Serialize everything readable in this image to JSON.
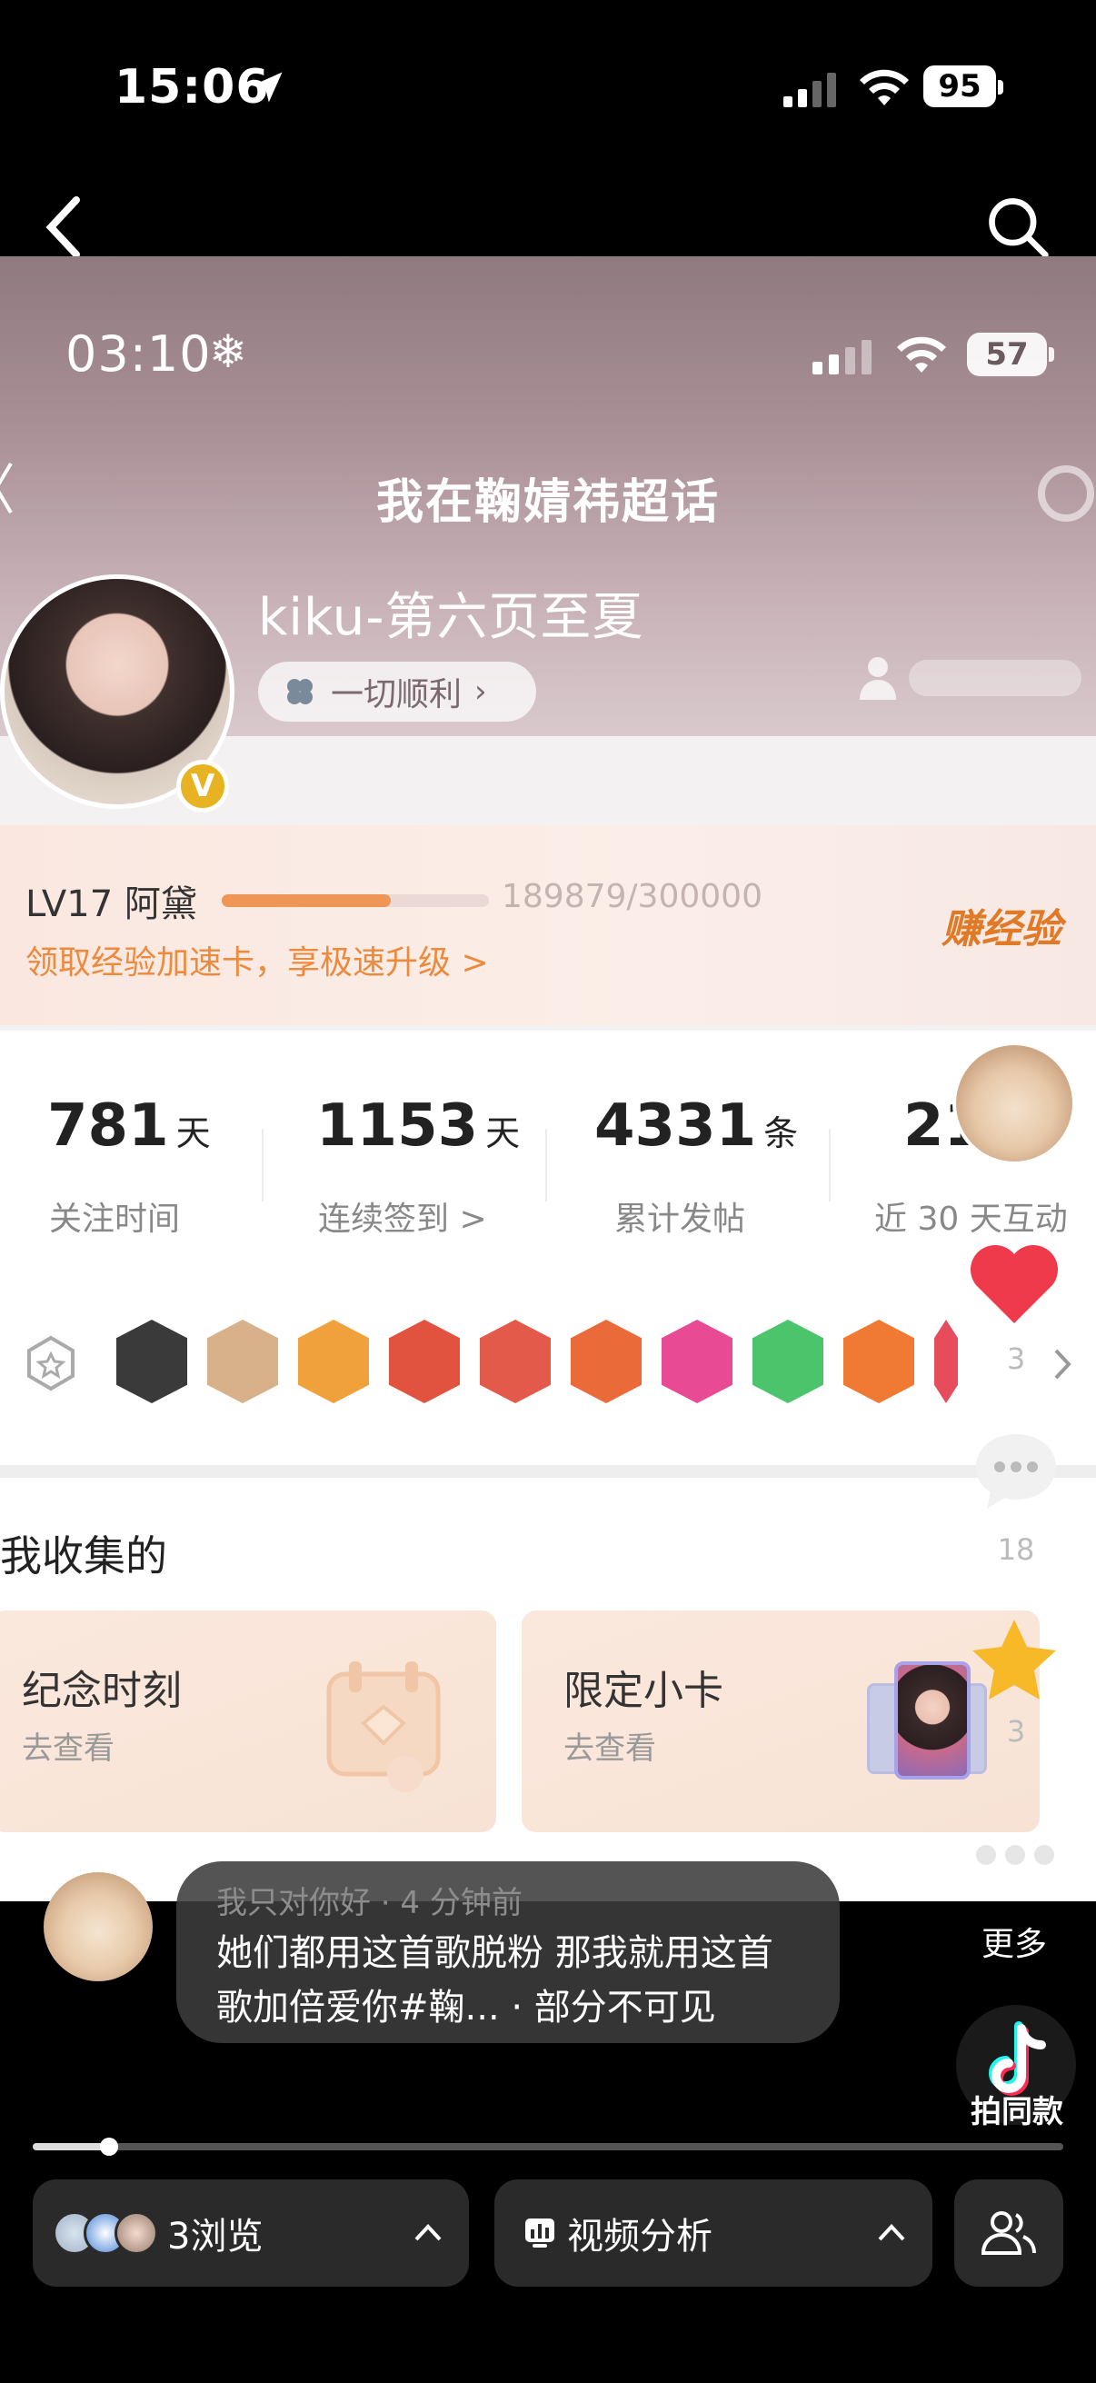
{
  "status_bar": {
    "time": "15:06",
    "battery": "95"
  },
  "video": {
    "inner_status": {
      "time": "03:10",
      "battery": "57"
    },
    "super_topic_title": "我在鞠婧祎超话",
    "username": "kiku-第六页至夏",
    "wish_pill": "一切顺利",
    "verified_mark": "V",
    "level": {
      "label": "LV17 阿黛",
      "current": 189879,
      "max": 300000,
      "count_text": "189879/300000",
      "promo": "领取经验加速卡，享极速升级 >",
      "earn_button": "赚经验"
    },
    "stats": [
      {
        "value": "781",
        "unit": "天",
        "label": "关注时间"
      },
      {
        "value": "1153",
        "unit": "天",
        "label": "连续签到 >"
      },
      {
        "value": "4331",
        "unit": "条",
        "label": "累计发帖"
      },
      {
        "value": "21",
        "unit": "",
        "label": "近 30 天互动"
      }
    ],
    "badges": [
      {
        "name": "crown-badge",
        "color": "#3a3a3a"
      },
      {
        "name": "girl-sticker-badge",
        "color": "#d8b08a"
      },
      {
        "name": "orange-crown-badge",
        "color": "#f1a13c"
      },
      {
        "name": "red-cat-badge",
        "color": "#e2533f"
      },
      {
        "name": "red-cat-badge-2",
        "color": "#e35a4a"
      },
      {
        "name": "red-orange-cat-badge",
        "color": "#ea6a3a"
      },
      {
        "name": "lv17-badge",
        "color": "#e84a94"
      },
      {
        "name": "green-hand-badge",
        "color": "#4cc46c"
      },
      {
        "name": "100-days-badge",
        "color": "#f07a34"
      },
      {
        "name": "partial-badge",
        "color": "#e74c5c"
      }
    ],
    "collect_title": "我收集的",
    "cards": [
      {
        "title": "纪念时刻",
        "sub": "去查看"
      },
      {
        "title": "限定小卡",
        "sub": "去查看"
      }
    ]
  },
  "rail": {
    "likes": "3",
    "comments": "18",
    "favorites": "3"
  },
  "comment": {
    "meta": "我只对你好 · 4 分钟前",
    "text_line1": "她们都用这首歌脱粉 那我就用这首",
    "text_line2": "歌加倍爱你#鞠... · 部分不可见",
    "more": "更多",
    "same_style": "拍同款"
  },
  "progress": {
    "fraction": 0.074
  },
  "bottom_bar": {
    "views": "3浏览",
    "analysis": "视频分析"
  },
  "colors": {
    "accent_orange": "#ef9555",
    "like_red": "#ee3a4a",
    "star_yellow": "#f7b928"
  }
}
